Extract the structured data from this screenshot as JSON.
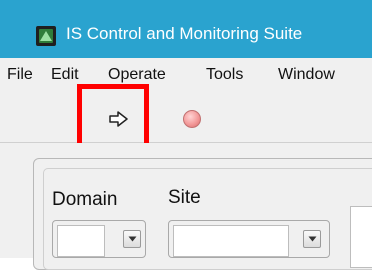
{
  "window": {
    "title": "IS Control and Monitoring Suite",
    "titlebar_color": "#2aa3cf"
  },
  "menu": {
    "items": [
      "File",
      "Edit",
      "Operate",
      "Tools",
      "Window"
    ]
  },
  "toolbar": {
    "run_icon": "run-arrow-icon",
    "stop_icon": "stop-icon",
    "highlight_color": "#ff0000"
  },
  "form": {
    "domain_label": "Domain",
    "site_label": "Site",
    "domain_value": "",
    "site_value": ""
  }
}
